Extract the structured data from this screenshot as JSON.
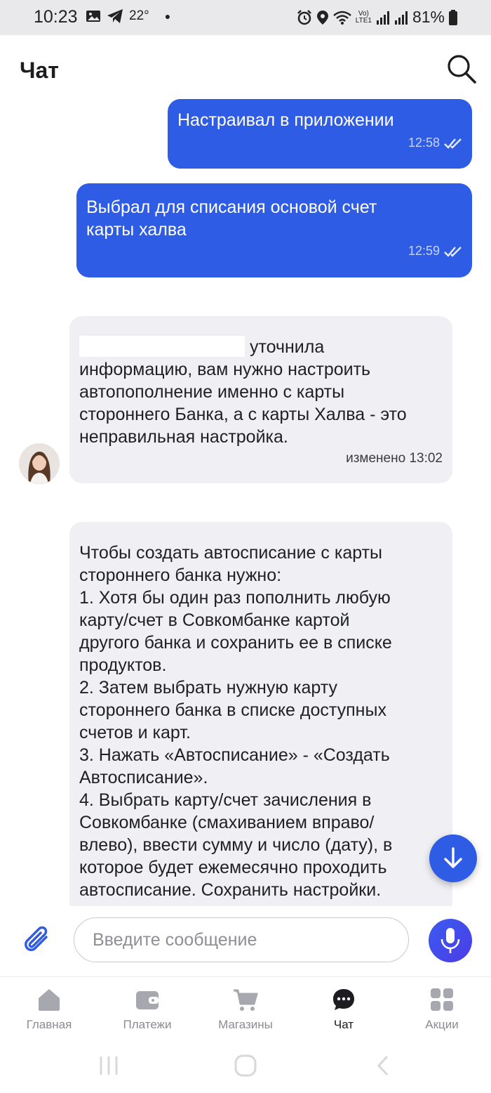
{
  "status_bar": {
    "time": "10:23",
    "temperature": "22°",
    "battery": "81%",
    "lte_label": "LTE1"
  },
  "header": {
    "title": "Чат"
  },
  "messages": [
    {
      "direction": "outgoing",
      "text": "Настраивал в приложении",
      "time": "12:58",
      "read": true
    },
    {
      "direction": "outgoing",
      "lines": [
        "Выбрал для списания основой счет",
        "карты халва"
      ],
      "time": "12:59",
      "read": true
    },
    {
      "direction": "incoming",
      "first_line_suffix": " уточнила",
      "lines": [
        "информацию, вам нужно настроить",
        "автопополнение именно с карты",
        "стороннего Банка, а с карты Халва - это",
        "неправильная настройка."
      ],
      "edited_label": "изменено 13:02"
    },
    {
      "direction": "incoming",
      "lines": [
        "Чтобы создать автосписание с карты",
        "стороннего банка нужно:",
        "1. Хотя бы один раз пополнить любую",
        "карту/счет в Совкомбанке картой",
        "другого банка и сохранить ее в списке",
        "продуктов.",
        "2. Затем выбрать нужную карту",
        "стороннего банка в списке доступных",
        "счетов и карт.",
        "3. Нажать «Автосписание» - «Создать",
        "Автосписание».",
        "4. Выбрать карту/счет зачисления в",
        "Совкомбанке (смахиванием вправо/",
        "влево), ввести сумму и число (дату), в",
        "которое будет ежемесячно проходить",
        "автосписание. Сохранить настройки."
      ]
    }
  ],
  "composer": {
    "placeholder": "Введите сообщение"
  },
  "nav": {
    "items": [
      {
        "label": "Главная",
        "icon": "home-icon"
      },
      {
        "label": "Платежи",
        "icon": "wallet-icon"
      },
      {
        "label": "Магазины",
        "icon": "cart-icon"
      },
      {
        "label": "Чат",
        "icon": "chat-icon",
        "active": true
      },
      {
        "label": "Акции",
        "icon": "grid-icon"
      }
    ]
  },
  "colors": {
    "accent": "#2f5ce4",
    "incoming_bubble": "#efeff4"
  }
}
